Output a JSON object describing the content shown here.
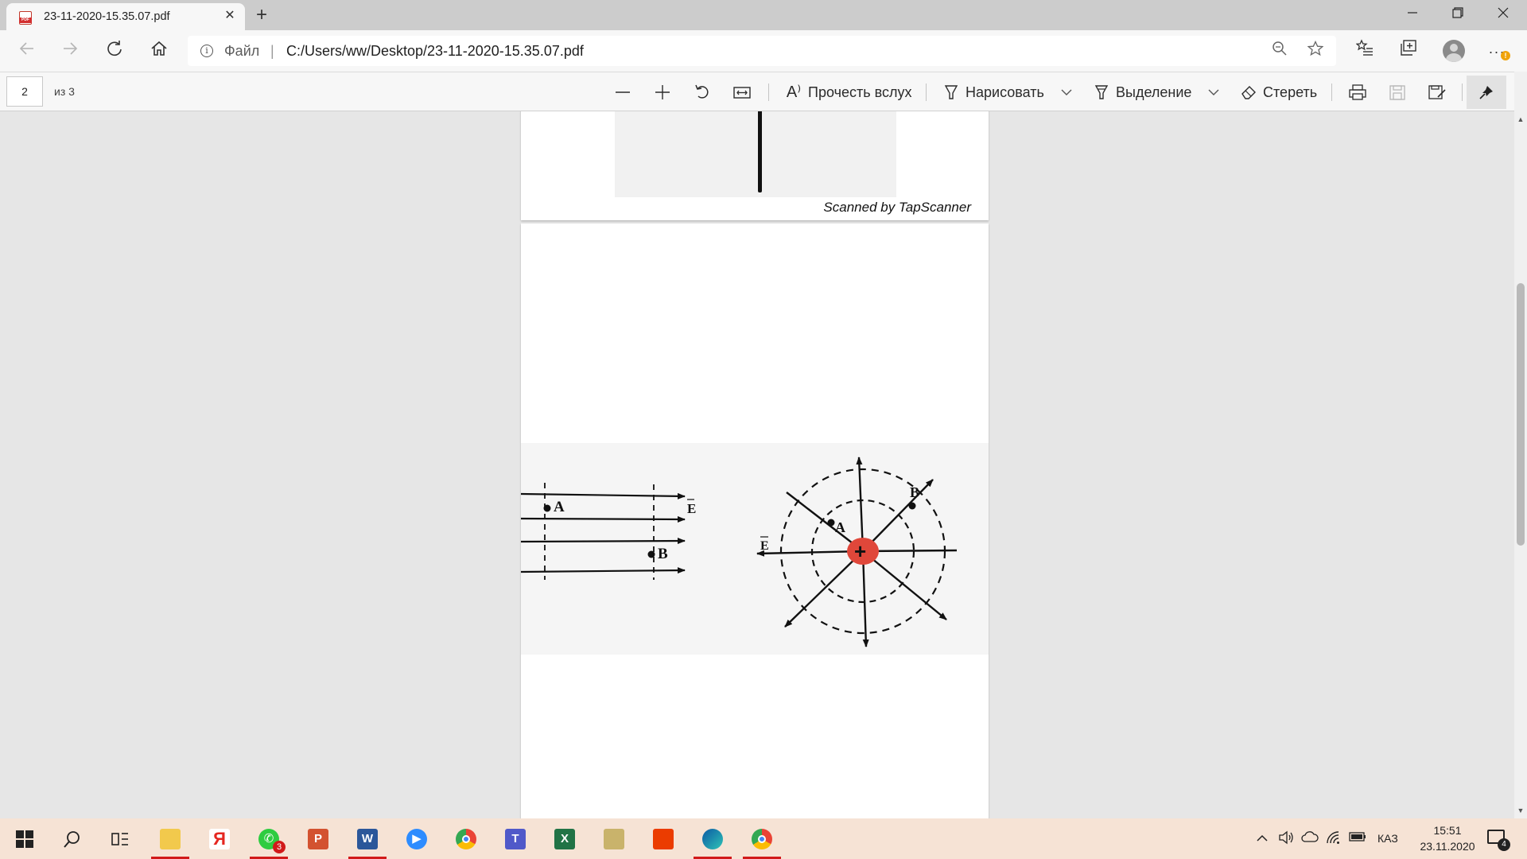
{
  "browser": {
    "tab": {
      "title": "23-11-2020-15.35.07.pdf",
      "icon": "pdf-file-icon"
    },
    "new_tab_glyph": "+",
    "window_controls": {
      "minimize": "—",
      "restore": "❐",
      "close": "✕"
    },
    "address": {
      "scheme_label": "Файл",
      "separator": "|",
      "url": "C:/Users/ww/Desktop/23-11-2020-15.35.07.pdf"
    },
    "notification_badge": "!"
  },
  "pdf_toolbar": {
    "page_current": "2",
    "page_total": "из 3",
    "zoom_out_glyph": "—",
    "zoom_in_glyph": "+",
    "read_aloud_label": "Прочесть вслух",
    "draw_label": "Нарисовать",
    "highlight_label": "Выделение",
    "erase_label": "Стереть"
  },
  "document": {
    "page1_footer": "Scanned by TapScanner",
    "figure_labels": {
      "left_a": "A",
      "left_b": "B",
      "left_e": "E",
      "right_a": "A",
      "right_b": "B",
      "right_e": "E",
      "charge": "+"
    },
    "colors": {
      "charge": "#e0473a",
      "ink": "#111111"
    }
  },
  "taskbar": {
    "apps": [
      {
        "name": "file-explorer",
        "active": true
      },
      {
        "name": "yandex-browser",
        "letter": "Я",
        "active": false
      },
      {
        "name": "whatsapp",
        "badge": "3",
        "active": true
      },
      {
        "name": "powerpoint",
        "letter": "P",
        "active": false
      },
      {
        "name": "word",
        "letter": "W",
        "active": true
      },
      {
        "name": "zoom",
        "active": false
      },
      {
        "name": "chrome",
        "active": false
      },
      {
        "name": "teams",
        "letter": "T",
        "active": false
      },
      {
        "name": "excel",
        "letter": "X",
        "active": false
      },
      {
        "name": "archive",
        "active": false
      },
      {
        "name": "office",
        "active": false
      },
      {
        "name": "edge",
        "active": true
      },
      {
        "name": "chrome-profile",
        "active": true
      }
    ],
    "language": "КАЗ",
    "time": "15:51",
    "date": "23.11.2020",
    "notification_count": "4"
  }
}
